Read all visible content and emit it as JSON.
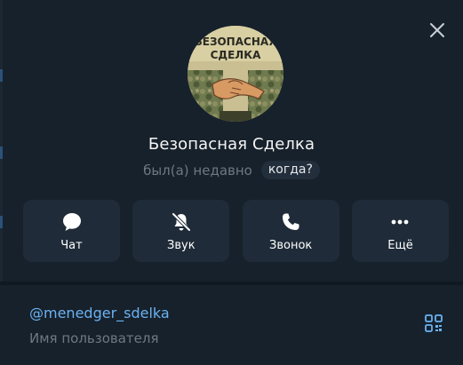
{
  "profile": {
    "name": "Безопасная Сделка",
    "status": "был(а) недавно",
    "when_label": "когда?",
    "avatar": {
      "line1": "БЕЗОПАСНАЯ",
      "line2": "СДЕЛКА",
      "icon": "handshake-icon"
    }
  },
  "actions": [
    {
      "label": "Чат",
      "icon": "chat-bubble-icon"
    },
    {
      "label": "Звук",
      "icon": "bell-muted-icon"
    },
    {
      "label": "Звонок",
      "icon": "phone-icon"
    },
    {
      "label": "Ещё",
      "icon": "more-dots-icon"
    }
  ],
  "info": {
    "username": "@menedger_sdelka",
    "username_caption": "Имя пользователя",
    "qr_icon": "qr-code-icon"
  },
  "close_icon": "close-icon",
  "colors": {
    "panel_bg": "#17212b",
    "button_bg": "#1f2b38",
    "accent_link": "#6ab2f2",
    "muted_text": "#6d7883"
  }
}
